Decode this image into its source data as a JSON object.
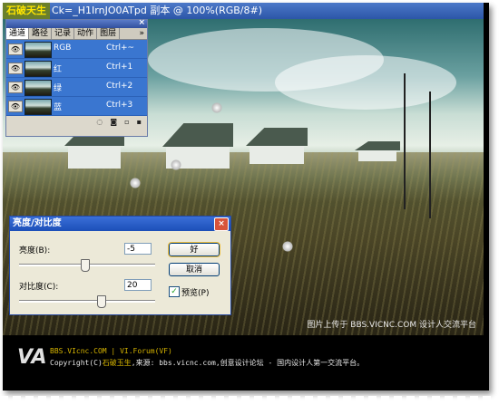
{
  "window": {
    "logo": "石破天生",
    "title": "Ck=_H1IrnJO0ATpd 副本 @ 100%(RGB/8#)"
  },
  "channels_panel": {
    "close": "×",
    "more": "»",
    "tabs": [
      "通道",
      "路径",
      "记录",
      "动作",
      "图层"
    ],
    "rows": [
      {
        "name": "RGB",
        "shortcut": "Ctrl+~"
      },
      {
        "name": "红",
        "shortcut": "Ctrl+1"
      },
      {
        "name": "绿",
        "shortcut": "Ctrl+2"
      },
      {
        "name": "蓝",
        "shortcut": "Ctrl+3"
      }
    ],
    "eye": "👁"
  },
  "dialog": {
    "title": "亮度/对比度",
    "close": "×",
    "brightness_label": "亮度(B):",
    "brightness_value": "-5",
    "contrast_label": "对比度(C):",
    "contrast_value": "20",
    "ok_label": "好",
    "cancel_label": "取消",
    "preview_label": "预览(P)",
    "preview_checked": "✓"
  },
  "photo": {
    "watermark": "图片上传于 BBS.VICNC.COM 设计人交流平台"
  },
  "footer": {
    "logo": "VA",
    "line1": "BBS.VIcnc.COM | VI.Forum(VF)",
    "line2_prefix": "Copyright(C)",
    "line2_name": "石破玉生",
    "line2_rest": ",来源: bbs.vicnc.com,创意设计论坛 - 国内设计人第一交流平台。"
  }
}
